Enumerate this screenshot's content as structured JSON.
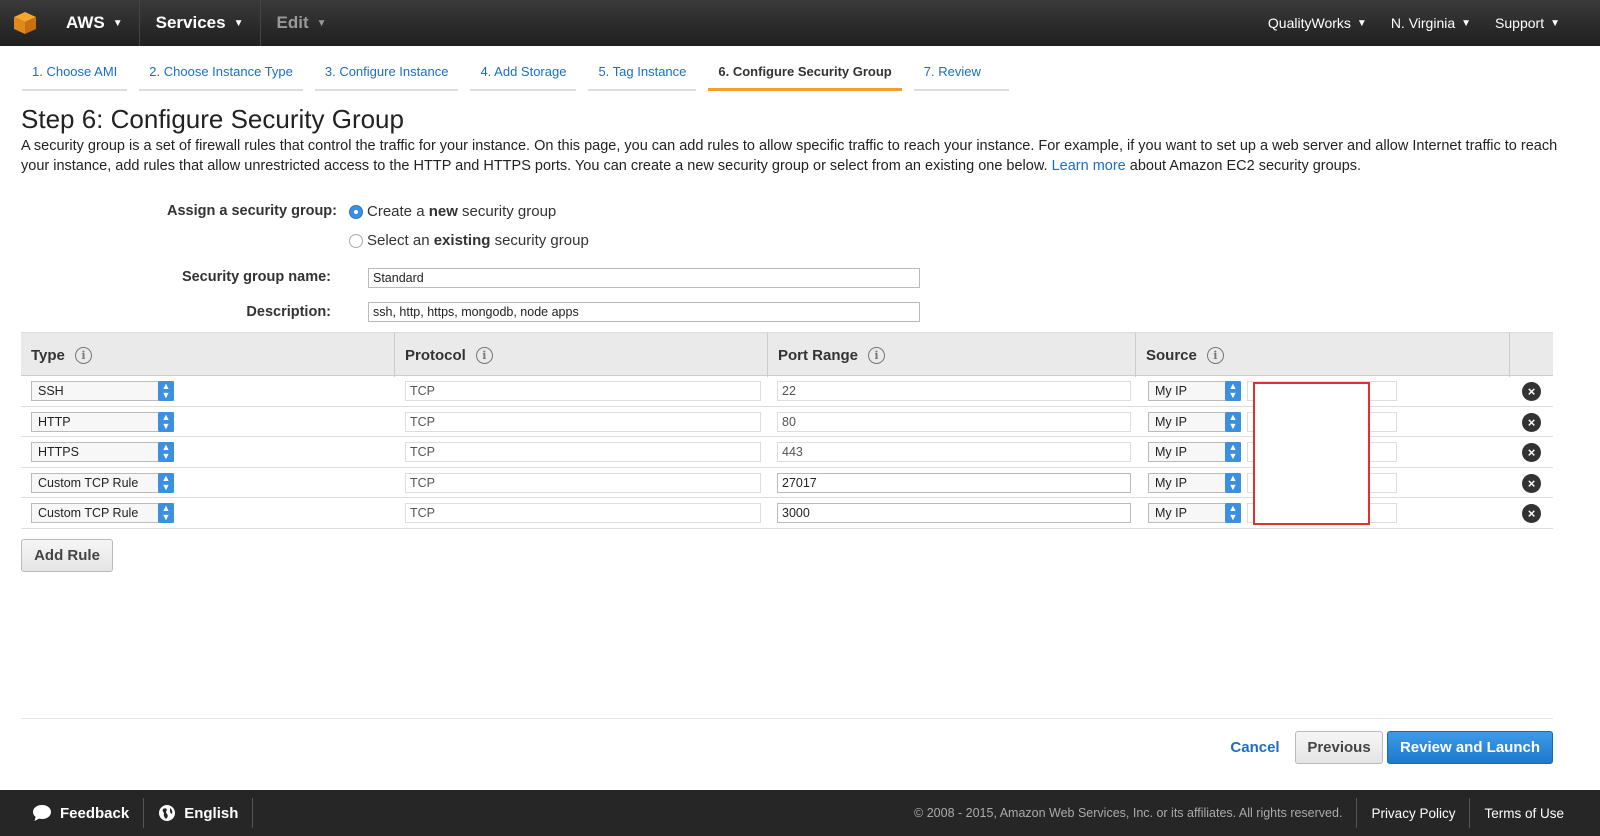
{
  "topbar": {
    "logo_icon": "aws-cube-icon",
    "aws_label": "AWS",
    "services_label": "Services",
    "edit_label": "Edit",
    "account_label": "QualityWorks",
    "region_label": "N. Virginia",
    "support_label": "Support"
  },
  "steps": [
    {
      "label": "1. Choose AMI"
    },
    {
      "label": "2. Choose Instance Type"
    },
    {
      "label": "3. Configure Instance"
    },
    {
      "label": "4. Add Storage"
    },
    {
      "label": "5. Tag Instance"
    },
    {
      "label": "6. Configure Security Group",
      "active": true
    },
    {
      "label": "7. Review"
    }
  ],
  "page": {
    "title": "Step 6: Configure Security Group",
    "intro_before": "A security group is a set of firewall rules that control the traffic for your instance. On this page, you can add rules to allow specific traffic to reach your instance. For example, if you want to set up a web server and allow Internet traffic to reach your instance, add rules that allow unrestricted access to the HTTP and HTTPS ports. You can create a new security group or select from an existing one below.",
    "learn_more": "Learn more",
    "intro_after": "about Amazon EC2 security groups."
  },
  "form": {
    "assign_label": "Assign a security group:",
    "radio_new_pre": "Create a ",
    "radio_new_bold": "new",
    "radio_new_post": " security group",
    "radio_existing_pre": "Select an ",
    "radio_existing_bold": "existing",
    "radio_existing_post": " security group",
    "selected": "new",
    "name_label": "Security group name:",
    "name_value": "Standard",
    "desc_label": "Description:",
    "desc_value": "ssh, http, https, mongodb, node apps"
  },
  "table": {
    "headers": {
      "type": "Type",
      "protocol": "Protocol",
      "port_range": "Port Range",
      "source": "Source"
    },
    "rows": [
      {
        "type": "SSH",
        "protocol": "TCP",
        "port": "22",
        "source": "My IP"
      },
      {
        "type": "HTTP",
        "protocol": "TCP",
        "port": "80",
        "source": "My IP"
      },
      {
        "type": "HTTPS",
        "protocol": "TCP",
        "port": "443",
        "source": "My IP"
      },
      {
        "type": "Custom TCP Rule",
        "protocol": "TCP",
        "port": "27017",
        "source": "My IP"
      },
      {
        "type": "Custom TCP Rule",
        "protocol": "TCP",
        "port": "3000",
        "source": "My IP"
      }
    ],
    "add_rule_label": "Add Rule"
  },
  "actions": {
    "cancel_label": "Cancel",
    "previous_label": "Previous",
    "review_label": "Review and Launch"
  },
  "footer": {
    "feedback_label": "Feedback",
    "language_label": "English",
    "copyright": "© 2008 - 2015, Amazon Web Services, Inc. or its affiliates. All rights reserved.",
    "privacy_label": "Privacy Policy",
    "terms_label": "Terms of Use"
  },
  "colors": {
    "accent_blue": "#1a6fc4",
    "active_tab": "#f0a030",
    "highlight_box": "#e03030",
    "topbar": "#232323"
  }
}
